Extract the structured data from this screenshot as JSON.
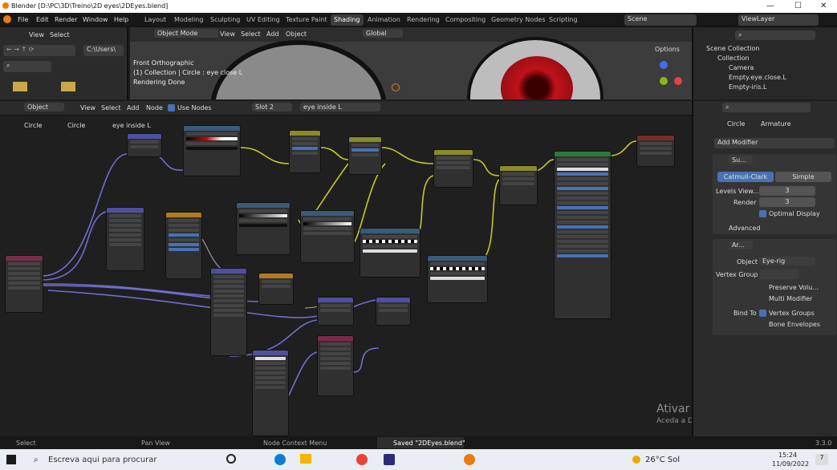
{
  "window": {
    "title": "Blender [D:\\PC\\3D\\Treino\\2D eyes\\2DEyes.blend]"
  },
  "menu": [
    "File",
    "Edit",
    "Render",
    "Window",
    "Help"
  ],
  "workspaces": [
    "Layout",
    "Modeling",
    "Sculpting",
    "UV Editing",
    "Texture Paint",
    "Shading",
    "Animation",
    "Rendering",
    "Compositing",
    "Geometry Nodes",
    "Scripting"
  ],
  "active_workspace": "Shading",
  "scene": "Scene",
  "view_layer": "ViewLayer",
  "filebrowser": {
    "view": "View",
    "select": "Select",
    "path": "C:\\Users\\"
  },
  "viewport": {
    "mode": "Object Mode",
    "menus": [
      "View",
      "Select",
      "Add",
      "Object"
    ],
    "transform": "Global",
    "info": [
      "Front Orthographic",
      "(1) Collection | Circle : eye close L",
      "Rendering Done"
    ],
    "options": "Options"
  },
  "outliner": {
    "items": [
      "Scene Collection",
      "Collection",
      "Camera",
      "Empty.eye.close.L",
      "Empty-iris.L"
    ]
  },
  "node_editor": {
    "type": "Object",
    "menus": [
      "View",
      "Select",
      "Add",
      "Node"
    ],
    "use_nodes": "Use Nodes",
    "slot": "Slot 2",
    "material": "eye inside L",
    "breadcrumb": [
      "Circle",
      "Circle",
      "eye inside L"
    ]
  },
  "properties": {
    "breadcrumb": [
      "Circle",
      "Armature"
    ],
    "add_modifier": "Add Modifier",
    "subsurf": {
      "name": "Su...",
      "tab_a": "Catmull-Clark",
      "tab_b": "Simple",
      "levels_label": "Levels View...",
      "levels_val": "3",
      "render_label": "Render",
      "render_val": "3",
      "optimal": "Optimal Display",
      "advanced": "Advanced"
    },
    "armature": {
      "name": "Ar...",
      "object_label": "Object",
      "object_val": "Eye-rig",
      "vgroup_label": "Vertex Group",
      "preserve": "Preserve Volu...",
      "multi": "Multi Modifier",
      "bind_label": "Bind To",
      "vertex_groups": "Vertex Groups",
      "bone_env": "Bone Envelopes"
    }
  },
  "watermark": {
    "line1": "Ativar o Windows",
    "line2": "Aceda a Definições para ativar o Windows."
  },
  "statusbar": {
    "select": "Select",
    "pan": "Pan View",
    "context": "Node Context Menu",
    "saved": "Saved \"2DEyes.blend\"",
    "version": "3.3.0"
  },
  "taskbar": {
    "search": "Escreva aqui para procurar",
    "weather": "26°C Sol",
    "time": "15:24",
    "date": "11/09/2022",
    "notif": "7"
  },
  "colors": {
    "accent": "#4772b3",
    "header_bg": "#2b2b2b"
  }
}
